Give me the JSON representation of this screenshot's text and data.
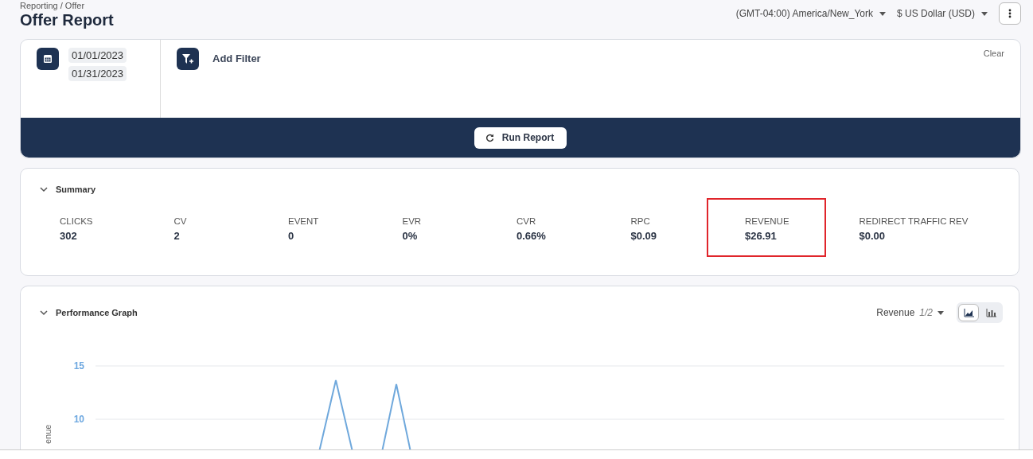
{
  "breadcrumb": "Reporting / Offer",
  "title": "Offer Report",
  "timezone": "(GMT-04:00) America/New_York",
  "currency": "$ US Dollar (USD)",
  "filters": {
    "start_date": "01/01/2023",
    "end_date": "01/31/2023",
    "add_filter": "Add Filter",
    "clear": "Clear",
    "run_button": "Run Report"
  },
  "summary": {
    "title": "Summary",
    "expanded": true,
    "metrics": [
      {
        "label": "CLICKS",
        "value": "302",
        "highlighted": false
      },
      {
        "label": "CV",
        "value": "2",
        "highlighted": false
      },
      {
        "label": "EVENT",
        "value": "0",
        "highlighted": false
      },
      {
        "label": "EVR",
        "value": "0%",
        "highlighted": false
      },
      {
        "label": "CVR",
        "value": "0.66%",
        "highlighted": false
      },
      {
        "label": "RPC",
        "value": "$0.09",
        "highlighted": false
      },
      {
        "label": "REVENUE",
        "value": "$26.91",
        "highlighted": true
      },
      {
        "label": "REDIRECT TRAFFIC REV",
        "value": "$0.00",
        "highlighted": false
      }
    ]
  },
  "performance": {
    "title": "Performance Graph",
    "expanded": true,
    "metric_select": "Revenue",
    "metric_page": "1/2",
    "view_modes": [
      {
        "kind": "line",
        "selected": true
      },
      {
        "kind": "bar",
        "selected": false
      }
    ],
    "chart": {
      "ylabel": "enue",
      "ytick_labels": [
        "15",
        "10"
      ]
    }
  }
}
